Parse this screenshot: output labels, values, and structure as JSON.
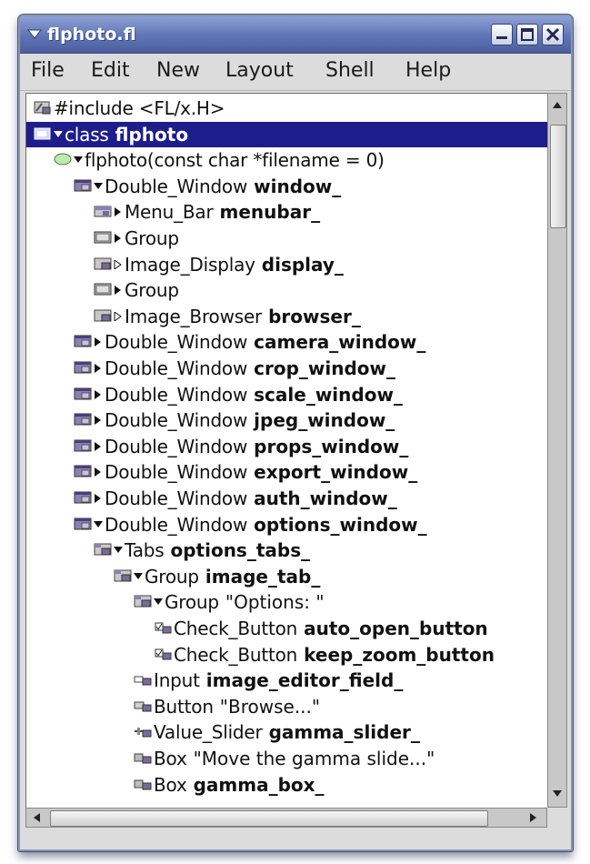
{
  "window": {
    "title": "flphoto.fl"
  },
  "menubar": {
    "items": [
      {
        "label": "File"
      },
      {
        "label": "Edit"
      },
      {
        "label": "New"
      },
      {
        "label": "Layout"
      },
      {
        "label": "Shell"
      },
      {
        "label": "Help"
      }
    ]
  },
  "tree": {
    "selected_index": 1,
    "rows": [
      {
        "indent": 0,
        "icon": "code-icon",
        "expander": "none",
        "cls": "#include <FL/x.H>",
        "name": "",
        "str": ""
      },
      {
        "indent": 0,
        "icon": "class-icon",
        "expander": "expanded",
        "cls": "class",
        "name": "flphoto",
        "str": ""
      },
      {
        "indent": 1,
        "icon": "function-icon",
        "expander": "expanded",
        "cls": "flphoto(const char *filename = 0)",
        "name": "",
        "str": ""
      },
      {
        "indent": 2,
        "icon": "window-icon",
        "expander": "expanded",
        "cls": "Double_Window",
        "name": "window_",
        "str": ""
      },
      {
        "indent": 3,
        "icon": "menubar-icon",
        "expander": "collapsed",
        "cls": "Menu_Bar",
        "name": "menubar_",
        "str": ""
      },
      {
        "indent": 3,
        "icon": "group-icon",
        "expander": "collapsed",
        "cls": "Group",
        "name": "",
        "str": ""
      },
      {
        "indent": 3,
        "icon": "widget-icon",
        "expander": "collapsed-open",
        "cls": "Image_Display",
        "name": "display_",
        "str": ""
      },
      {
        "indent": 3,
        "icon": "group-icon",
        "expander": "collapsed",
        "cls": "Group",
        "name": "",
        "str": ""
      },
      {
        "indent": 3,
        "icon": "widget-icon",
        "expander": "collapsed-open",
        "cls": "Image_Browser",
        "name": "browser_",
        "str": ""
      },
      {
        "indent": 2,
        "icon": "window-icon",
        "expander": "collapsed",
        "cls": "Double_Window",
        "name": "camera_window_",
        "str": ""
      },
      {
        "indent": 2,
        "icon": "window-icon",
        "expander": "collapsed",
        "cls": "Double_Window",
        "name": "crop_window_",
        "str": ""
      },
      {
        "indent": 2,
        "icon": "window-icon",
        "expander": "collapsed",
        "cls": "Double_Window",
        "name": "scale_window_",
        "str": ""
      },
      {
        "indent": 2,
        "icon": "window-icon",
        "expander": "collapsed",
        "cls": "Double_Window",
        "name": "jpeg_window_",
        "str": ""
      },
      {
        "indent": 2,
        "icon": "window-icon",
        "expander": "collapsed",
        "cls": "Double_Window",
        "name": "props_window_",
        "str": ""
      },
      {
        "indent": 2,
        "icon": "window-icon",
        "expander": "collapsed",
        "cls": "Double_Window",
        "name": "export_window_",
        "str": ""
      },
      {
        "indent": 2,
        "icon": "window-icon",
        "expander": "collapsed",
        "cls": "Double_Window",
        "name": "auth_window_",
        "str": ""
      },
      {
        "indent": 2,
        "icon": "window-icon",
        "expander": "expanded",
        "cls": "Double_Window",
        "name": "options_window_",
        "str": ""
      },
      {
        "indent": 3,
        "icon": "tabs-icon",
        "expander": "expanded",
        "cls": "Tabs",
        "name": "options_tabs_",
        "str": ""
      },
      {
        "indent": 4,
        "icon": "tabs-icon",
        "expander": "expanded",
        "cls": "Group",
        "name": "image_tab_",
        "str": ""
      },
      {
        "indent": 5,
        "icon": "tabs-icon",
        "expander": "expanded",
        "cls": "Group",
        "name": "",
        "str": "\"Options: \""
      },
      {
        "indent": 6,
        "icon": "checkbox-icon",
        "expander": "none",
        "cls": "Check_Button",
        "name": "auto_open_button",
        "str": ""
      },
      {
        "indent": 6,
        "icon": "checkbox-icon",
        "expander": "none",
        "cls": "Check_Button",
        "name": "keep_zoom_button",
        "str": ""
      },
      {
        "indent": 5,
        "icon": "input-icon",
        "expander": "none",
        "cls": "Input",
        "name": "image_editor_field_",
        "str": ""
      },
      {
        "indent": 5,
        "icon": "button-icon",
        "expander": "none",
        "cls": "Button",
        "name": "",
        "str": "\"Browse...\""
      },
      {
        "indent": 5,
        "icon": "slider-icon",
        "expander": "none",
        "cls": "Value_Slider",
        "name": "gamma_slider_",
        "str": ""
      },
      {
        "indent": 5,
        "icon": "box-icon",
        "expander": "none",
        "cls": "Box",
        "name": "",
        "str": "\"Move the gamma slide...\""
      },
      {
        "indent": 5,
        "icon": "box-icon",
        "expander": "none",
        "cls": "Box",
        "name": "gamma_box_",
        "str": ""
      }
    ]
  },
  "colors": {
    "selection": "#1d1d8c",
    "titlebar": "#5f74b4",
    "chrome": "#dcdcdc"
  }
}
